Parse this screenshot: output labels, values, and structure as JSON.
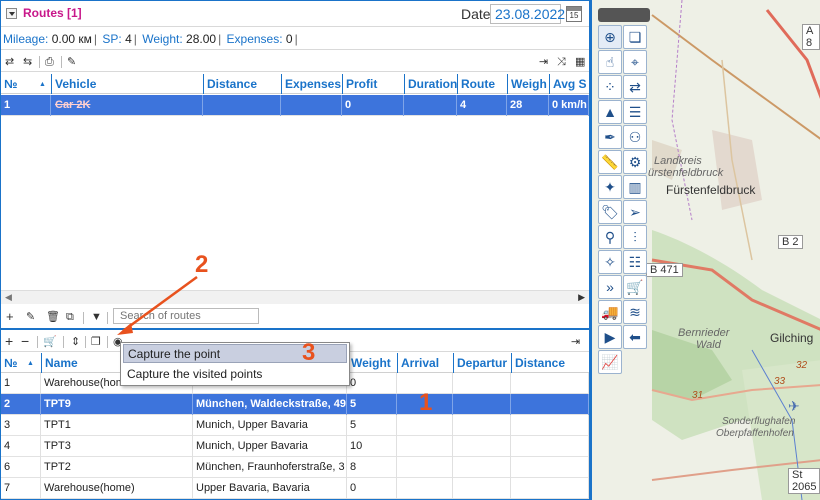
{
  "header": {
    "title": "Routes [1]",
    "date_label": "Date",
    "date_value": "23.08.2022",
    "calendar_day": "15"
  },
  "stats": {
    "mileage_label": "Mileage:",
    "mileage_value": "0.00 км",
    "sp_label": "SP:",
    "sp_value": "4",
    "weight_label": "Weight:",
    "weight_value": "28.00",
    "expenses_label": "Expenses:",
    "expenses_value": "0"
  },
  "routes_table": {
    "columns": [
      "№",
      "Vehicle",
      "Distance",
      "Expenses",
      "Profit",
      "Duration",
      "Route",
      "Weigh",
      "Avg S"
    ],
    "rows": [
      [
        "1",
        "Car 2K",
        "",
        "",
        "0",
        "",
        "4",
        "28",
        "0 km/h"
      ]
    ]
  },
  "search": {
    "placeholder": "Search of routes"
  },
  "points_table": {
    "columns": [
      "№",
      "Name",
      "",
      "Weight",
      "Arrival",
      "Departur",
      "Distance"
    ],
    "rows": [
      [
        "1",
        "Warehouse(hom",
        "",
        "0",
        "",
        "",
        ""
      ],
      [
        "2",
        "TPT9",
        "München, Waldeckstraße, 49",
        "5",
        "",
        "",
        ""
      ],
      [
        "3",
        "TPT1",
        "Munich, Upper Bavaria",
        "5",
        "",
        "",
        ""
      ],
      [
        "4",
        "TPT3",
        "Munich, Upper Bavaria",
        "10",
        "",
        "",
        ""
      ],
      [
        "6",
        "TPT2",
        "München, Fraunhoferstraße, 3",
        "8",
        "",
        "",
        ""
      ],
      [
        "7",
        "Warehouse(home)",
        "Upper Bavaria, Bavaria",
        "0",
        "",
        "",
        ""
      ]
    ]
  },
  "context_menu": {
    "items": [
      "Capture the point",
      "Capture the visited points"
    ]
  },
  "annotations": {
    "a1": "1",
    "a2": "2",
    "a3": "3"
  },
  "map": {
    "labels": {
      "landkreis": "Landkreis",
      "fuerstenfeldbruck_area": "ürstenfeldbruck",
      "fuerstenfeldbruck": "Fürstenfeldbruck",
      "bernrieder1": "Bernrieder",
      "bernrieder2": "Wald",
      "gilching": "Gilching",
      "sonder1": "Sonderflughafen",
      "sonder2": "Oberpfaffenhofen"
    },
    "roads": [
      "A 8",
      "B 2",
      "B 471",
      "St 2065"
    ],
    "route_numbers": [
      "31",
      "32",
      "33"
    ]
  },
  "colors": {
    "accent": "#1a73c9",
    "title": "#c8178a",
    "selected": "#3d74dc",
    "annotation": "#e8521e"
  }
}
